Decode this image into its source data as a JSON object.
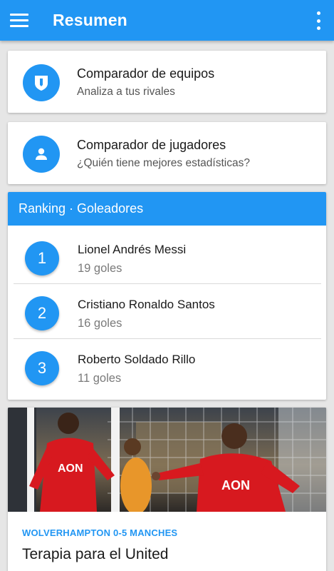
{
  "appbar": {
    "title": "Resumen",
    "menu_icon": "hamburger-menu-icon",
    "overflow_icon": "more-vertical-icon",
    "color": "#2196f3"
  },
  "features": [
    {
      "title": "Comparador de equipos",
      "subtitle": "Analiza a tus rivales",
      "icon": "shield-icon"
    },
    {
      "title": "Comparador de jugadores",
      "subtitle": "¿Quién tiene mejores estadísticas?",
      "icon": "person-icon"
    }
  ],
  "ranking": {
    "header": "Ranking · Goleadores",
    "players": [
      {
        "position": "1",
        "name": "Lionel Andrés Messi",
        "goals": "19 goles"
      },
      {
        "position": "2",
        "name": "Cristiano Ronaldo Santos",
        "goals": "16 goles"
      },
      {
        "position": "3",
        "name": "Roberto Soldado Rillo",
        "goals": "11 goles"
      }
    ]
  },
  "news": {
    "kicker": "WOLVERHAMPTON 0-5 MANCHES",
    "title": "Terapia para el United",
    "image": "football-players-celebrating-photo",
    "shirt_sponsor": "AON"
  }
}
